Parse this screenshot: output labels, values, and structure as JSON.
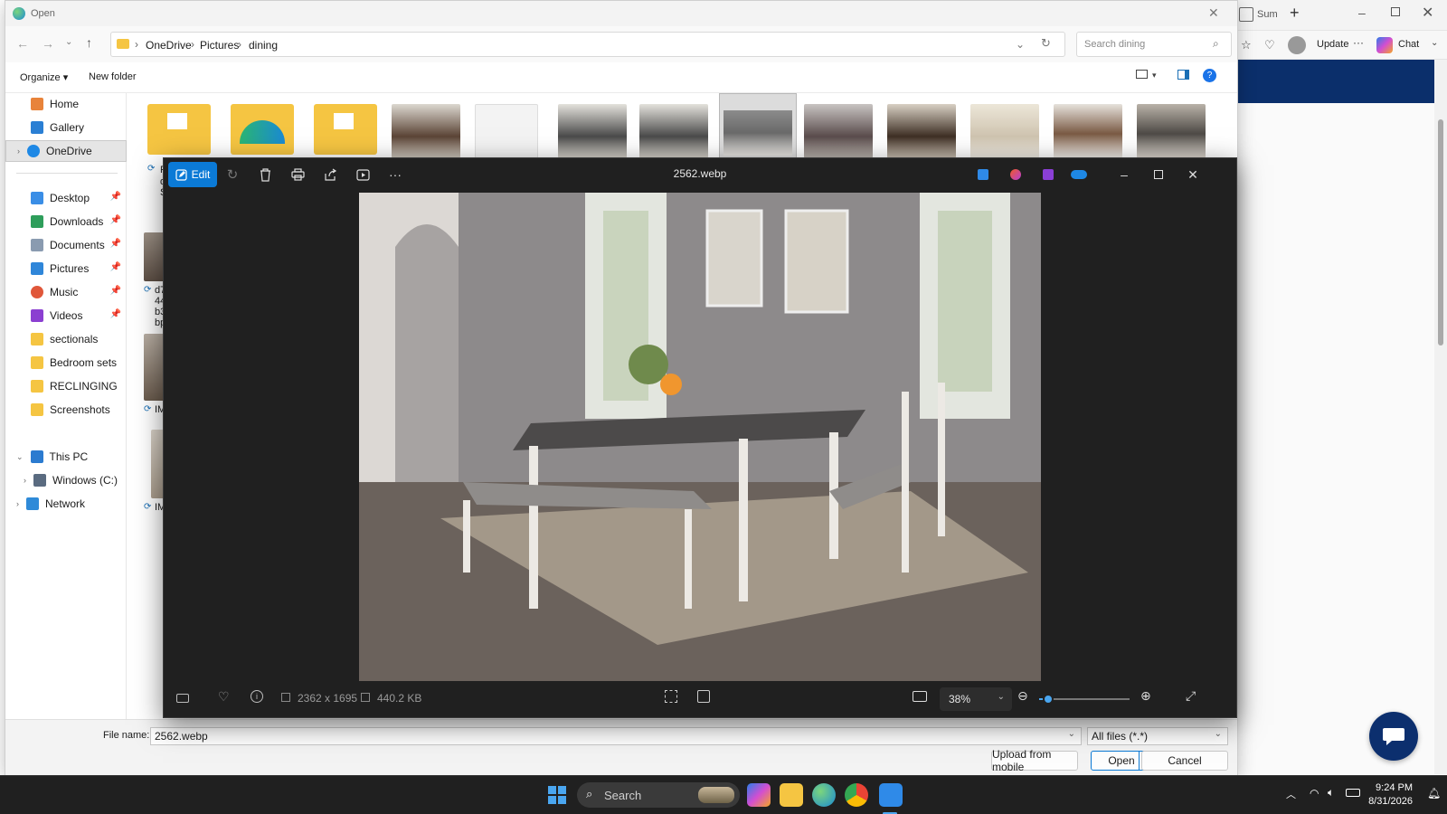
{
  "dialog": {
    "title": "Open",
    "breadcrumb": [
      "OneDrive",
      "Pictures",
      "dining"
    ],
    "search_placeholder": "Search dining",
    "organize_label": "Organize",
    "new_folder_label": "New folder",
    "nav": {
      "home": "Home",
      "gallery": "Gallery",
      "onedrive": "OneDrive",
      "desktop": "Desktop",
      "downloads": "Downloads",
      "documents": "Documents",
      "pictures": "Pictures",
      "music": "Music",
      "videos": "Videos",
      "sectionals": "sectionals",
      "bedroom_sets": "Bedroom sets",
      "reclining": "RECLINGING",
      "screenshots": "Screenshots",
      "this_pc": "This PC",
      "windows_c": "Windows (C:)",
      "network": "Network"
    },
    "partial_labels": {
      "f": "F",
      "d": "d",
      "s": "S",
      "d74": "d7",
      "n44": "44",
      "b3": "b3",
      "bp": "bp",
      "im1": "IM",
      "im2": "IM"
    },
    "file_name_label": "File name:",
    "file_name_value": "2562.webp",
    "file_type_value": "All files (*.*)",
    "upload_label": "Upload from mobile",
    "open_label": "Open",
    "cancel_label": "Cancel"
  },
  "viewer": {
    "edit_label": "Edit",
    "file_title": "2562.webp",
    "dimensions": "2362 x 1695",
    "file_size": "440.2 KB",
    "zoom": "38%",
    "zoom_slider_value": 0.1
  },
  "browser": {
    "tab_label": "Sum",
    "update_label": "Update",
    "chat_label": "Chat"
  },
  "taskbar": {
    "search_placeholder": "Search",
    "time": "9:24 PM",
    "date": "8/31/2026"
  },
  "colors": {
    "accent": "#0b7ad6",
    "viewer_bg": "#202020",
    "banner": "#0b2f6b",
    "folder": "#f5c542"
  }
}
